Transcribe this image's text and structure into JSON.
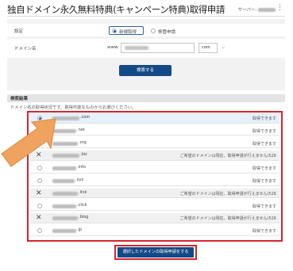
{
  "header": {
    "title": "独自ドメイン永久無料特典(キャンペーン特典)取得申請",
    "server_label": "サーバー:"
  },
  "form": {
    "setting_label": "設定",
    "option_new": "新規取得",
    "option_transfer": "移管申請",
    "domain_label": "ドメイン名",
    "prefix": "www.",
    "tld_value": "com",
    "search_button": "検索する"
  },
  "results": {
    "section_title": "検索結果",
    "note": "ドメイン名の取得状況です。取得可能なものからお選びください。",
    "rows": [
      {
        "tld": ".com",
        "status": "取得できます",
        "state": "selected"
      },
      {
        "tld": ".net",
        "status": "取得できます",
        "state": "available"
      },
      {
        "tld": ".org",
        "status": "取得できます",
        "state": "available"
      },
      {
        "tld": ".biz",
        "status": "ご希望のドメインは現在、取得申請が行えません(526",
        "state": "unavailable"
      },
      {
        "tld": ".info",
        "status": "取得できます",
        "state": "available"
      },
      {
        "tld": ".xyz",
        "status": "取得できます",
        "state": "available"
      },
      {
        "tld": ".link",
        "status": "ご希望のドメインは現在、取得申請が行えません(526",
        "state": "unavailable"
      },
      {
        "tld": ".click",
        "status": "取得できます",
        "state": "available"
      },
      {
        "tld": ".blog",
        "status": "ご希望のドメインは現在、取得申請が行えません(526",
        "state": "unavailable"
      },
      {
        "tld": ".jp",
        "status": "取得できます",
        "state": "available"
      }
    ],
    "apply_button": "選択したドメインの取得申請をする"
  },
  "colors": {
    "highlight": "#d9232d",
    "button": "#134a85",
    "arrow": "#f0a35e"
  },
  "icons": {
    "selected": "radio-checked-icon",
    "available": "radio-icon",
    "unavailable": "x-icon",
    "menu": "kebab-icon",
    "pointer": "arrow-icon"
  }
}
